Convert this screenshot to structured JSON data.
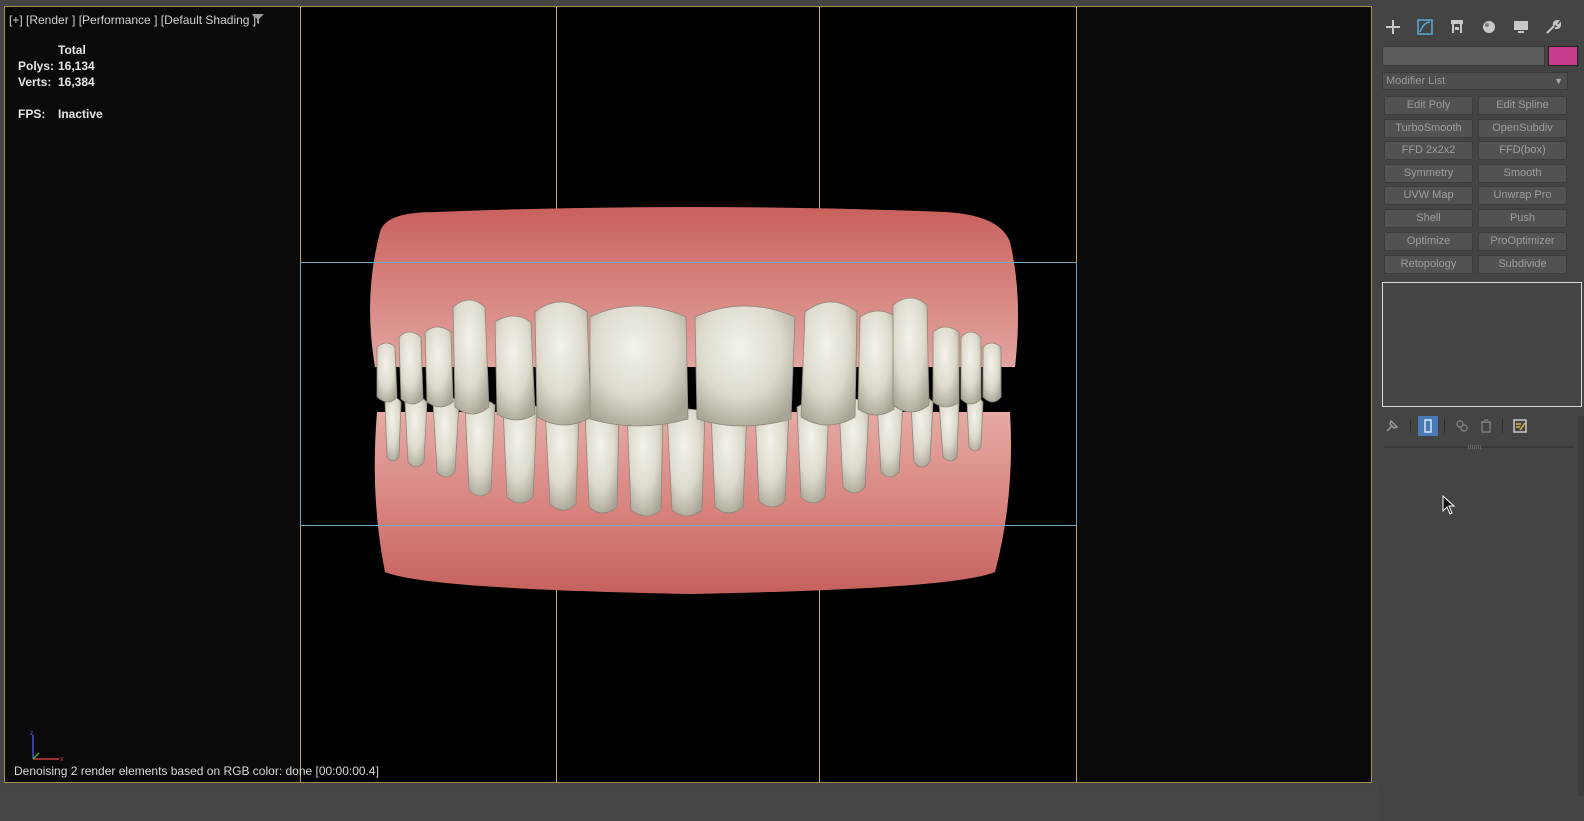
{
  "viewport": {
    "label": "[+] [Render ] [Performance ] [Default Shading ]",
    "stats": {
      "header": "Total",
      "polys_label": "Polys:",
      "polys_value": "16,134",
      "verts_label": "Verts:",
      "verts_value": "16,384",
      "fps_label": "FPS:",
      "fps_value": "Inactive"
    },
    "status": "Denoising 2 render elements based on RGB color: done [00:00:00.4]"
  },
  "command_panel": {
    "tabs": [
      "create-icon",
      "modify-icon",
      "hierarchy-icon",
      "motion-icon",
      "display-icon",
      "utilities-icon"
    ],
    "swatch_color": "#c93d8d",
    "modifier_list_label": "Modifier List",
    "modifier_buttons": [
      "Edit Poly",
      "Edit Spline",
      "TurboSmooth",
      "OpenSubdiv",
      "FFD 2x2x2",
      "FFD(box)",
      "Symmetry",
      "Smooth",
      "UVW Map",
      "Unwrap Pro",
      "Shell",
      "Push",
      "Optimize",
      "ProOptimizer",
      "Retopology",
      "Subdivide"
    ]
  },
  "colors": {
    "viewport_frame": "#a88c4a",
    "safe_frame_guides": "#c9a55a",
    "region_box": "#6fa8c0",
    "active_tool": "#4a7ab5"
  }
}
